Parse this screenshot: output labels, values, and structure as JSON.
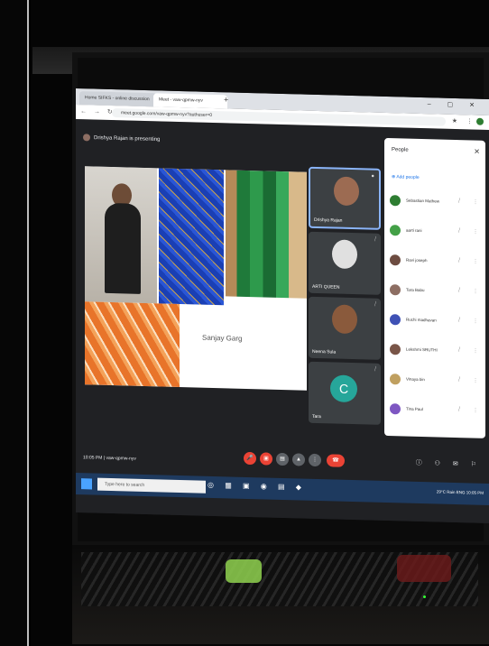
{
  "browser": {
    "tabs": [
      {
        "label": "Home SIFKS - online discussion"
      },
      {
        "label": "Meet - vaw-qpmw-nyv"
      }
    ],
    "url": "meet.google.com/vaw-qpmw-nyv?authuser=0"
  },
  "meet": {
    "presenter_text": "Drishya Rajan is presenting",
    "slide_caption": "Sanjay Garg",
    "tiles": [
      {
        "name": "Drishya Rajan",
        "face": "#9c6b52"
      },
      {
        "name": "ARTI QUEEN",
        "face": "#e0e0e0"
      },
      {
        "name": "Neena Sula",
        "face": "#8a5a3c"
      },
      {
        "name": "Tara",
        "initial": "C"
      }
    ],
    "people": {
      "title": "People",
      "add_label": "Add people",
      "participants": [
        {
          "name": "Sebastian Mathew",
          "color": "#2e7d32"
        },
        {
          "name": "aarti rani",
          "color": "#43a047"
        },
        {
          "name": "Ravi joseph",
          "color": "#6d4c41"
        },
        {
          "name": "Tara Babu",
          "color": "#8d6e63"
        },
        {
          "name": "Ruchi madhavan",
          "color": "#3f51b5"
        },
        {
          "name": "Lekshmi SRUTHI",
          "color": "#795548"
        },
        {
          "name": "Vinaya bin",
          "color": "#c0a060"
        },
        {
          "name": "Tina Paul",
          "color": "#7e57c2"
        }
      ]
    },
    "bottom_left": "10:05 PM | vaw-qpmw-nyv"
  },
  "taskbar": {
    "search_placeholder": "Type here to search",
    "tray_text": "29°C Rain  ENG  10:05 PM"
  },
  "colors": {
    "meet_bg": "#202124",
    "end_call": "#ea4335",
    "taskbar": "#1e3a5f"
  }
}
